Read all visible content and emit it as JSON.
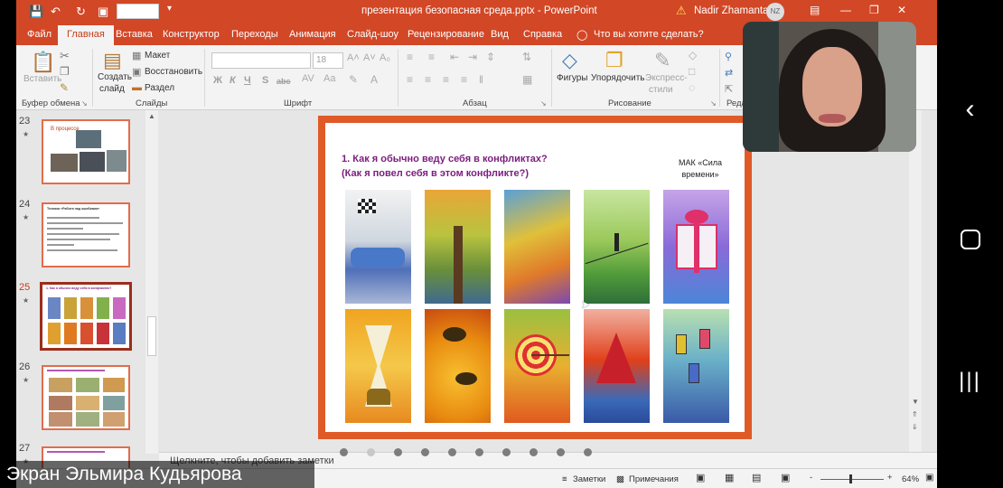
{
  "title_bar": {
    "document_title": "презентация безопасная среда.pptx - PowerPoint",
    "user_name": "Nadir Zhamantay",
    "user_initials": "NZ",
    "warning_icon": "warning-icon"
  },
  "menu_tabs": [
    {
      "label": "Файл",
      "active": false
    },
    {
      "label": "Главная",
      "active": true
    },
    {
      "label": "Вставка",
      "active": false
    },
    {
      "label": "Конструктор",
      "active": false
    },
    {
      "label": "Переходы",
      "active": false
    },
    {
      "label": "Анимация",
      "active": false
    },
    {
      "label": "Слайд-шоу",
      "active": false
    },
    {
      "label": "Рецензирование",
      "active": false
    },
    {
      "label": "Вид",
      "active": false
    },
    {
      "label": "Справка",
      "active": false
    }
  ],
  "tell_me": "Что вы хотите сделать?",
  "ribbon": {
    "clipboard": {
      "paste": "Вставить",
      "group_label": "Буфер обмена"
    },
    "slides": {
      "new_slide_line1": "Создать",
      "new_slide_line2": "слайд",
      "layout": "Макет",
      "reset": "Восстановить",
      "section": "Раздел",
      "group_label": "Слайды"
    },
    "font": {
      "font_name": "",
      "font_size": "18",
      "group_label": "Шрифт",
      "buttons": [
        "Ж",
        "К",
        "Ч",
        "S",
        "abc"
      ]
    },
    "paragraph": {
      "group_label": "Абзац"
    },
    "drawing": {
      "shapes": "Фигуры",
      "arrange": "Упорядочить",
      "styles_line1": "Экспресс-",
      "styles_line2": "стили",
      "group_label": "Рисование"
    },
    "editing": {
      "group_label_partial": "Реда"
    }
  },
  "slides": [
    {
      "number": "23",
      "title": "В процессе"
    },
    {
      "number": "24",
      "title": "Техника «Работа над ошибками»"
    },
    {
      "number": "25",
      "title": "1. Как я обычно веду себя в конфликтах?",
      "active": true
    },
    {
      "number": "26",
      "title": ""
    },
    {
      "number": "27",
      "title": ""
    }
  ],
  "current_slide": {
    "question_line1": "1. Как я обычно веду себя в конфликтах?",
    "question_line2": "(Как я повел себя в этом конфликте?)",
    "deck_label_line1": "МАК «Сила",
    "deck_label_line2": "времени»",
    "cards": [
      {
        "subject": "racing-car-flag-card"
      },
      {
        "subject": "tree-card"
      },
      {
        "subject": "winding-road-card"
      },
      {
        "subject": "tightrope-walker-card"
      },
      {
        "subject": "gift-box-card"
      },
      {
        "subject": "hourglass-card"
      },
      {
        "subject": "bees-honeycomb-card"
      },
      {
        "subject": "target-arrow-card"
      },
      {
        "subject": "sailing-ship-card"
      },
      {
        "subject": "phones-card"
      }
    ]
  },
  "notes_placeholder": "Щелкните, чтобы добавить заметки",
  "status_bar": {
    "notes": "Заметки",
    "comments": "Примечания",
    "zoom_level": "64%",
    "zoom_minus": "-",
    "zoom_plus": "+"
  },
  "screen_share_caption": "Экран Эльмира Кудьярова",
  "carousel_dot_count": 10,
  "colors": {
    "ppt_accent": "#d24726",
    "slide_frame": "#e05a27",
    "heading": "#7a1d7d"
  }
}
